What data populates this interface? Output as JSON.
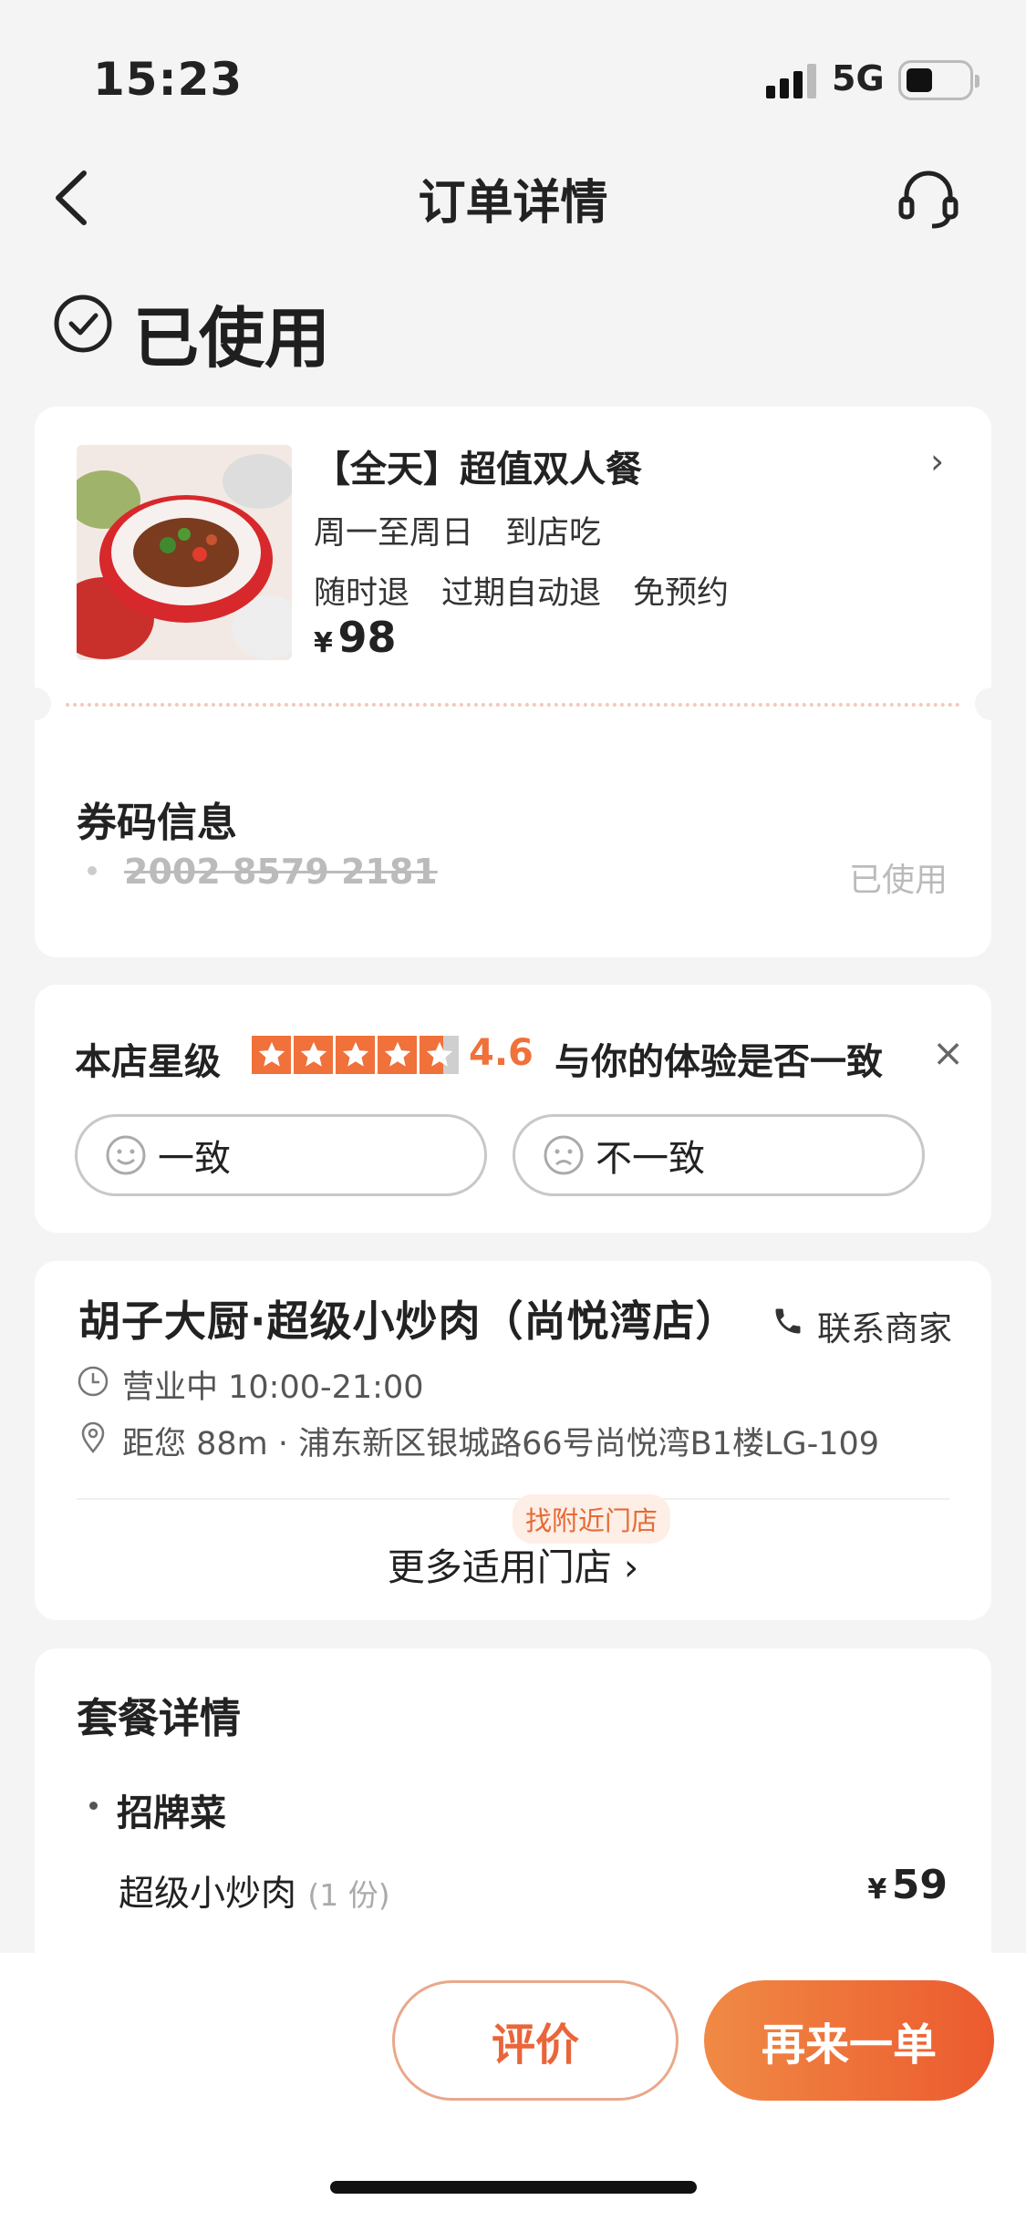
{
  "status_bar": {
    "time": "15:23",
    "network": "5G"
  },
  "nav": {
    "title": "订单详情"
  },
  "order_status": "已使用",
  "deal": {
    "title": "【全天】超值双人餐",
    "line1": "周一至周日　到店吃",
    "line2": "随时退　过期自动退　免预约",
    "currency": "¥",
    "price": "98"
  },
  "coupon": {
    "title": "券码信息",
    "code": "2002 8579 2181",
    "status": "已使用"
  },
  "rating": {
    "label": "本店星级",
    "score": "4.6",
    "stars": 4.6,
    "question": "与你的体验是否一致",
    "close": "×",
    "agree": "一致",
    "disagree": "不一致"
  },
  "shop": {
    "name": "胡子大厨·超级小炒肉（尚悦湾店）",
    "contact": "联系商家",
    "hours": "营业中 10:00-21:00",
    "location": "距您 88m · 浦东新区银城路66号尚悦湾B1楼LG-109",
    "nearby_tag": "找附近门店",
    "more_stores": "更多适用门店 ›"
  },
  "package": {
    "title": "套餐详情",
    "category": "招牌菜",
    "item": "超级小炒肉",
    "qty": "(1 份)",
    "currency": "¥",
    "price": "59"
  },
  "actions": {
    "review": "评价",
    "reorder": "再来一单"
  },
  "colors": {
    "accent": "#f0713a",
    "brand_gradient_start": "#f08a45",
    "brand_gradient_end": "#ec5a2e"
  }
}
